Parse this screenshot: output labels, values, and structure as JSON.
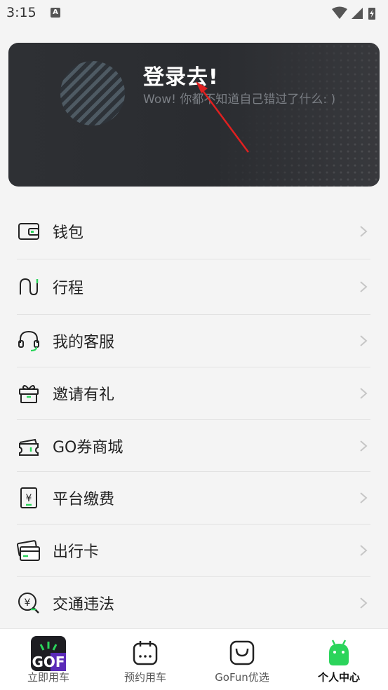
{
  "status_bar": {
    "time": "3:15",
    "notification_icon": "A"
  },
  "login_card": {
    "title": "登录去!",
    "subtitle": "Wow! 你都不知道自己错过了什么: )"
  },
  "menu": {
    "items": [
      {
        "label": "钱包",
        "icon": "wallet-icon"
      },
      {
        "label": "行程",
        "icon": "trip-icon"
      },
      {
        "label": "我的客服",
        "icon": "headset-icon"
      },
      {
        "label": "邀请有礼",
        "icon": "gift-icon"
      },
      {
        "label": "GO券商城",
        "icon": "coupon-icon"
      },
      {
        "label": "平台缴费",
        "icon": "payment-icon"
      },
      {
        "label": "出行卡",
        "icon": "card-icon"
      },
      {
        "label": "交通违法",
        "icon": "traffic-violation-icon"
      }
    ]
  },
  "tab_bar": {
    "tabs": [
      {
        "label": "立即用车",
        "icon": "gofun-logo-icon",
        "active": false
      },
      {
        "label": "预约用车",
        "icon": "calendar-icon",
        "active": false
      },
      {
        "label": "GoFun优选",
        "icon": "shopping-bag-icon",
        "active": false
      },
      {
        "label": "个人中心",
        "icon": "android-icon",
        "active": true
      }
    ]
  },
  "colors": {
    "accent": "#2bd45b",
    "annotation_arrow": "#e02020",
    "card_bg": "#2c2e32"
  }
}
